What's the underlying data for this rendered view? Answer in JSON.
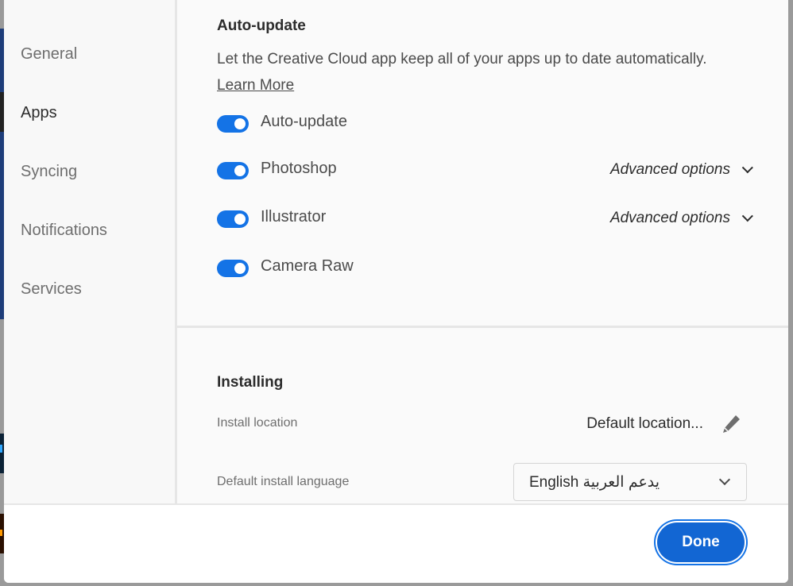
{
  "sidebar": {
    "items": [
      {
        "label": "General",
        "active": false
      },
      {
        "label": "Apps",
        "active": true
      },
      {
        "label": "Syncing",
        "active": false
      },
      {
        "label": "Notifications",
        "active": false
      },
      {
        "label": "Services",
        "active": false
      }
    ]
  },
  "auto_update": {
    "title": "Auto-update",
    "description": "Let the Creative Cloud app keep all of your apps up to date automatically.",
    "learn_more": "Learn More",
    "toggles": [
      {
        "label": "Auto-update",
        "on": true,
        "advanced": null
      },
      {
        "label": "Photoshop",
        "on": true,
        "advanced": "Advanced options"
      },
      {
        "label": "Illustrator",
        "on": true,
        "advanced": "Advanced options"
      },
      {
        "label": "Camera Raw",
        "on": true,
        "advanced": null
      }
    ]
  },
  "installing": {
    "title": "Installing",
    "install_location_label": "Install location",
    "install_location_value": "Default location...",
    "language_label": "Default install language",
    "language_value": "English يدعم العربية"
  },
  "footer": {
    "done_label": "Done"
  },
  "colors": {
    "accent": "#1473e6",
    "button": "#1266d3"
  }
}
